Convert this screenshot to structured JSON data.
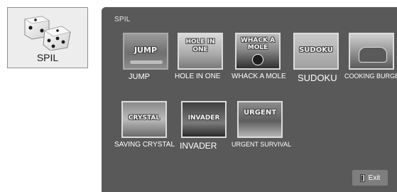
{
  "app_tile": {
    "label": "SPIL",
    "icon": "dice-icon"
  },
  "panel": {
    "title": "SPIL"
  },
  "games": [
    {
      "label": "JUMP",
      "thumb_text": "JUMP",
      "icon": "game-thumbnail"
    },
    {
      "label": "HOLE IN ONE",
      "thumb_text": "HOLE IN ONE",
      "icon": "game-thumbnail"
    },
    {
      "label": "WHACK A MOLE",
      "thumb_text": "WHACK A MOLE",
      "icon": "game-thumbnail"
    },
    {
      "label": "SUDOKU",
      "thumb_text": "SUDOKU",
      "icon": "game-thumbnail"
    },
    {
      "label": "COOKING BURGER",
      "thumb_text": "",
      "icon": "game-thumbnail"
    },
    {
      "label": "SAVING CRYSTAL",
      "thumb_text": "CRYSTAL",
      "icon": "game-thumbnail"
    },
    {
      "label": "INVADER",
      "thumb_text": "INVADER",
      "icon": "game-thumbnail"
    },
    {
      "label": "URGENT SURVIVAL",
      "thumb_text": "URGENT",
      "icon": "game-thumbnail"
    }
  ],
  "exit": {
    "label": "Exit",
    "icon": "exit-door-icon"
  },
  "colors": {
    "panel_bg": "#595959",
    "tile_bg": "#ededed",
    "exit_bg": "#7e7e7e",
    "text_light": "#ffffff"
  }
}
